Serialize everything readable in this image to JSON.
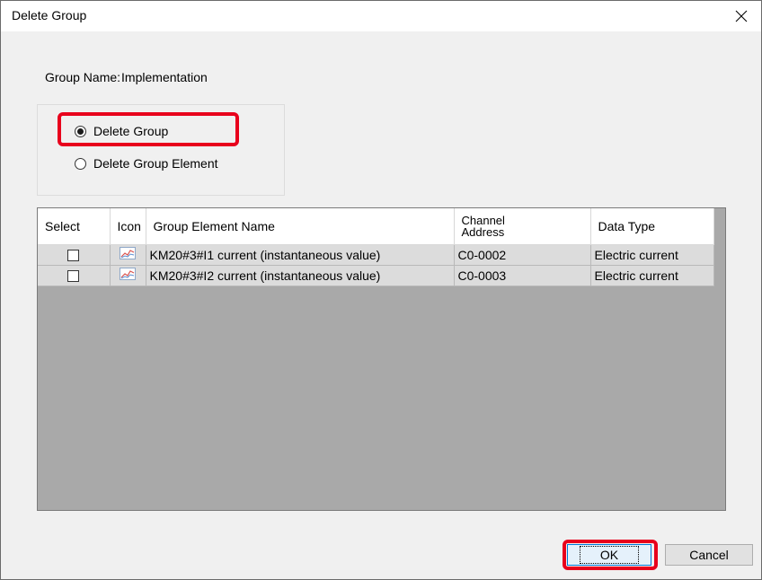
{
  "window": {
    "title": "Delete Group",
    "close_icon": "close-icon"
  },
  "group_name": {
    "label": "Group Name",
    "separator": ":",
    "value": "Implementation"
  },
  "options": [
    {
      "label": "Delete Group",
      "selected": true
    },
    {
      "label": "Delete Group Element",
      "selected": false
    }
  ],
  "table": {
    "headers": {
      "select": "Select",
      "icon": "Icon",
      "name": "Group Element Name",
      "channel_line1": "Channel",
      "channel_line2": "Address",
      "data_type": "Data Type"
    },
    "rows": [
      {
        "checked": false,
        "icon": "line-chart-icon",
        "name": "KM20#3#I1 current (instantaneous value)",
        "channel": "C0-0002",
        "data_type": "Electric current"
      },
      {
        "checked": false,
        "icon": "line-chart-icon",
        "name": "KM20#3#I2 current (instantaneous value)",
        "channel": "C0-0003",
        "data_type": "Electric current"
      }
    ]
  },
  "buttons": {
    "ok": "OK",
    "cancel": "Cancel"
  },
  "colors": {
    "highlight": "#e8001c",
    "grid_background": "#a9a9a9",
    "row_background": "#dcdcdc"
  }
}
